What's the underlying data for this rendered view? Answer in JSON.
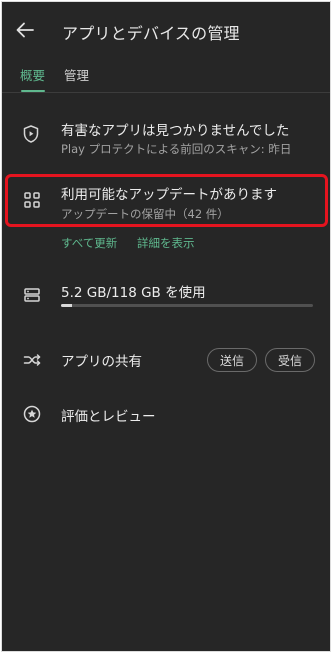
{
  "header": {
    "title": "アプリとデバイスの管理"
  },
  "tabs": [
    {
      "label": "概要",
      "active": true
    },
    {
      "label": "管理",
      "active": false
    }
  ],
  "protect": {
    "title": "有害なアプリは見つかりませんでした",
    "subtitle": "Play プロテクトによる前回のスキャン: 昨日"
  },
  "updates": {
    "title": "利用可能なアップデートがあります",
    "subtitle": "アップデートの保留中（42 件）",
    "update_all": "すべて更新",
    "see_details": "詳細を表示"
  },
  "storage": {
    "label": "5.2 GB/118 GB を使用",
    "used_fraction": 0.044
  },
  "share": {
    "title": "アプリの共有",
    "send": "送信",
    "receive": "受信"
  },
  "ratings": {
    "title": "評価とレビュー"
  },
  "colors": {
    "background": "#262626",
    "accent": "#5fb88e",
    "highlight": "#e5141f"
  },
  "icons": {
    "back": "arrow-left",
    "protect": "shield-play",
    "updates": "apps-grid",
    "storage": "storage-drive",
    "share": "share-arrows",
    "ratings": "star-circle"
  }
}
